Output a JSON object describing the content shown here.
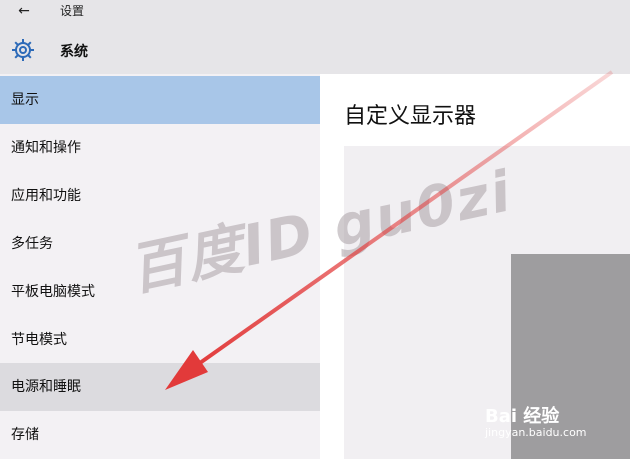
{
  "window": {
    "title": "设置",
    "back_icon": "back-arrow-icon"
  },
  "header": {
    "title": "系统",
    "icon": "gear-icon"
  },
  "sidebar": {
    "items": [
      {
        "label": "显示",
        "state": "selected"
      },
      {
        "label": "通知和操作",
        "state": ""
      },
      {
        "label": "应用和功能",
        "state": ""
      },
      {
        "label": "多任务",
        "state": ""
      },
      {
        "label": "平板电脑模式",
        "state": ""
      },
      {
        "label": "节电模式",
        "state": ""
      },
      {
        "label": "电源和睡眠",
        "state": "hover"
      },
      {
        "label": "存储",
        "state": ""
      }
    ]
  },
  "main": {
    "title": "自定义显示器"
  },
  "overlay": {
    "watermark": "百度ID gu0zi",
    "logo_text": "Bai 经验",
    "logo_url": "jingyan.baidu.com"
  },
  "colors": {
    "selected": "#a8c6e8",
    "hover": "#dcdbdf",
    "arrow": "#e23a3a"
  }
}
